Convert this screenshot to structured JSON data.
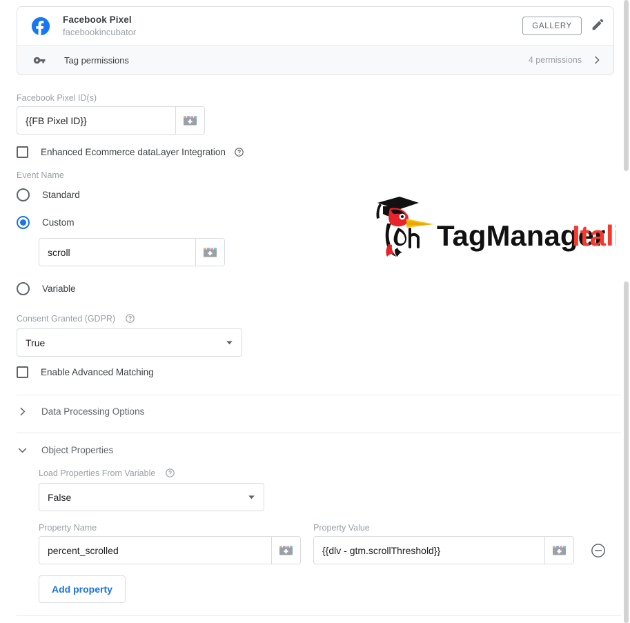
{
  "tag_card": {
    "icon": "facebook-icon",
    "title": "Facebook Pixel",
    "subtitle": "facebookincubator",
    "gallery_label": "GALLERY",
    "edit_icon": "pencil-icon",
    "permissions": {
      "icon": "key-icon",
      "label": "Tag permissions",
      "count_label": "4 permissions",
      "chevron": "chevron-right-icon"
    }
  },
  "form": {
    "pixel_ids": {
      "label": "Facebook Pixel ID(s)",
      "value": "{{FB Pixel ID}}",
      "placeholder": "",
      "variable_picker_icon": "variable-picker-icon"
    },
    "enhanced_ecommerce": {
      "label": "Enhanced Ecommerce dataLayer Integration",
      "checked": false,
      "help_icon": "help-icon"
    },
    "event_name": {
      "label": "Event Name",
      "options": [
        "Standard",
        "Custom",
        "Variable"
      ],
      "selected": "Custom",
      "custom_value": "scroll",
      "custom_placeholder": "",
      "variable_picker_icon": "variable-picker-icon"
    },
    "consent": {
      "label": "Consent Granted (GDPR)",
      "help_icon": "help-icon",
      "value": "True",
      "caret_icon": "caret-down-icon"
    },
    "advanced_matching": {
      "label": "Enable Advanced Matching",
      "checked": false
    },
    "data_processing": {
      "label": "Data Processing Options",
      "chevron": "chevron-right-icon",
      "expanded": false
    },
    "object_properties": {
      "label": "Object Properties",
      "chevron": "chevron-down-icon",
      "expanded": true,
      "load_from_variable": {
        "label": "Load Properties From Variable",
        "help_icon": "help-icon",
        "value": "False",
        "caret_icon": "caret-down-icon"
      },
      "table": {
        "headers": [
          "Property Name",
          "Property Value"
        ],
        "rows": [
          {
            "name": "percent_scrolled",
            "value": "{{dlv - gtm.scrollThreshold}}",
            "name_picker_icon": "variable-picker-icon",
            "value_picker_icon": "variable-picker-icon",
            "remove_icon": "remove-circle-icon"
          }
        ]
      },
      "add_button": "Add property"
    }
  },
  "watermark": {
    "name": "tagmanageritalia-logo",
    "text_primary": "TagManager",
    "text_accent": "Italia",
    "accent_color": "#f23a2e"
  },
  "colors": {
    "accent_blue": "#1a73e8",
    "facebook_blue": "#1877f2",
    "text_primary": "#3c4043",
    "text_secondary": "#9aa0a6",
    "border": "#dadce0"
  }
}
